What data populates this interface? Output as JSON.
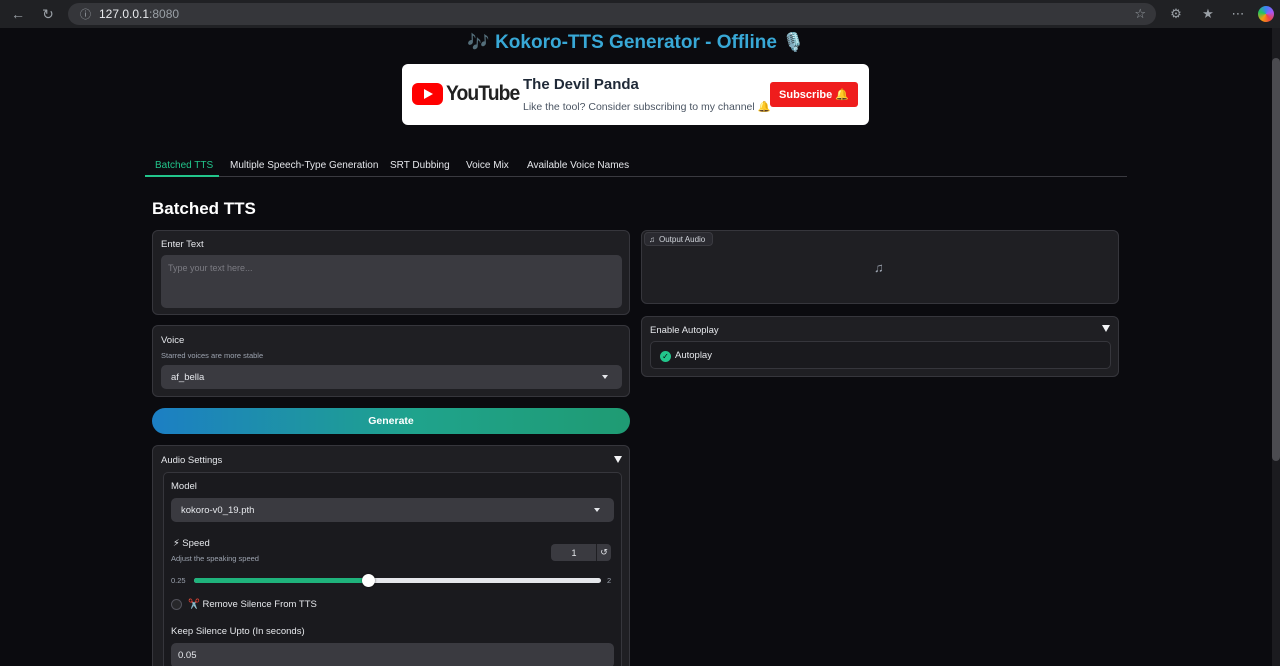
{
  "browser": {
    "url_host": "127.0.0.1",
    "url_port": ":8080"
  },
  "app": {
    "title": "Kokoro-TTS Generator - Offline",
    "title_icon_left": "🎶",
    "title_icon_right": "🎙️"
  },
  "youtube": {
    "logo_text": "YouTube",
    "channel_name": "The Devil Panda",
    "tagline": "Like the tool? Consider subscribing to my channel 🔔",
    "subscribe_label": "Subscribe 🔔"
  },
  "tabs": [
    {
      "label": "Batched TTS",
      "active": true
    },
    {
      "label": "Multiple Speech-Type Generation",
      "active": false
    },
    {
      "label": "SRT Dubbing",
      "active": false
    },
    {
      "label": "Voice Mix",
      "active": false
    },
    {
      "label": "Available Voice Names",
      "active": false
    }
  ],
  "section_title": "Batched TTS",
  "text_input": {
    "label": "Enter Text",
    "placeholder": "Type your text here..."
  },
  "voice": {
    "label": "Voice",
    "info": "Starred voices are more stable",
    "selected": "af_bella"
  },
  "generate_label": "Generate",
  "audio_settings": {
    "title": "Audio Settings",
    "model_label": "Model",
    "model_selected": "kokoro-v0_19.pth",
    "speed_label": "⚡ Speed",
    "speed_info": "Adjust the speaking speed",
    "speed_value": "1",
    "speed_min": "0.25",
    "speed_max": "2",
    "speed_fraction": 0.4286,
    "remove_silence_label": "✂️ Remove Silence From TTS",
    "keep_silence_label": "Keep Silence Upto (In seconds)",
    "keep_silence_value": "0.05"
  },
  "output_audio": {
    "label": "Output Audio"
  },
  "autoplay": {
    "panel_title": "Enable Autoplay",
    "checkbox_label": "Autoplay",
    "checked": true
  },
  "colors": {
    "accent_green": "#22c58b",
    "title_blue": "#38a8d6",
    "youtube_red": "#ff0000"
  }
}
